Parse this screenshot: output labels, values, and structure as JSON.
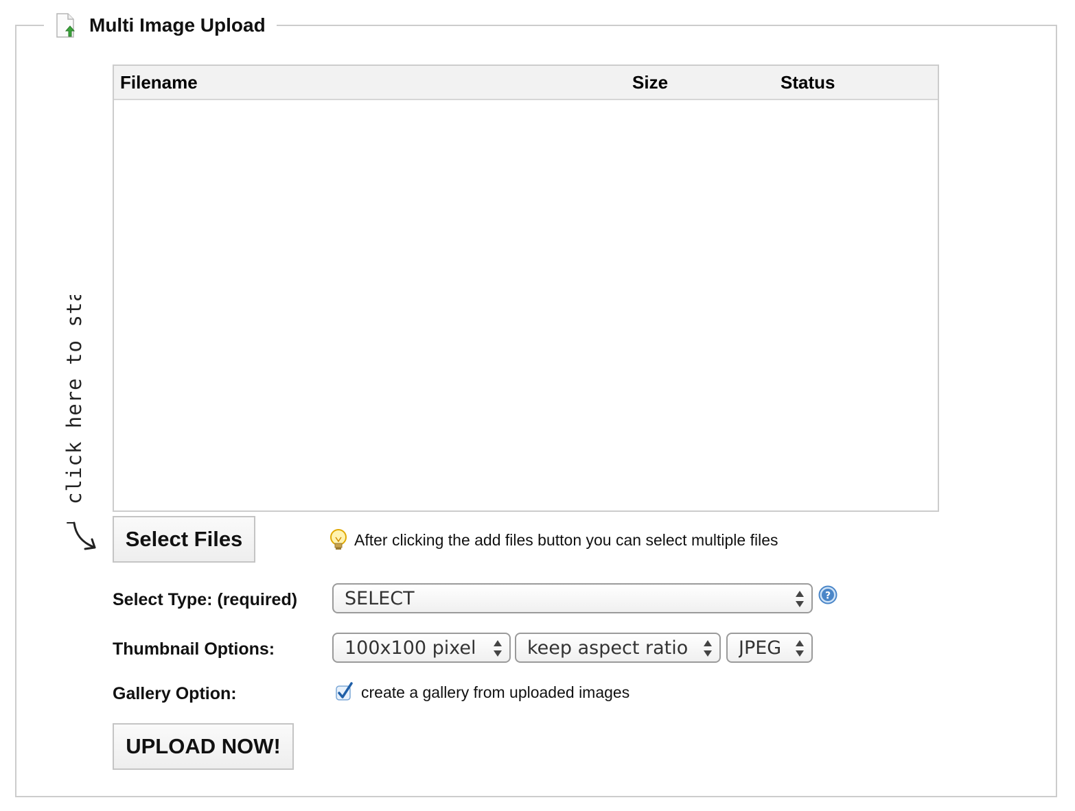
{
  "panel": {
    "title": "Multi Image Upload",
    "icon": "upload-file-icon"
  },
  "file_table": {
    "columns": [
      "Filename",
      "Size",
      "Status"
    ],
    "rows": []
  },
  "hint": {
    "text": "click here to start",
    "icon": "curved-arrow-icon"
  },
  "select_files_button": "Select Files",
  "tip": {
    "icon": "lightbulb-icon",
    "text": "After clicking the add files button you can select multiple files"
  },
  "form": {
    "select_type_label": "Select Type: (required)",
    "select_type_value": "SELECT",
    "help_icon": "help-icon",
    "thumbnail_label": "Thumbnail Options:",
    "thumbnail_size_value": "100x100 pixel",
    "thumbnail_ratio_value": "keep aspect ratio",
    "thumbnail_format_value": "JPEG",
    "gallery_label": "Gallery Option:",
    "gallery_checkbox_label": "create a gallery from uploaded images",
    "gallery_checked": true
  },
  "upload_button": "UPLOAD NOW!",
  "colors": {
    "border": "#cccccc",
    "table_header_bg": "#f2f2f2",
    "checkbox_check": "#1f5fa8",
    "help_blue": "#4a86c8",
    "upload_icon_green": "#3aa33a"
  }
}
